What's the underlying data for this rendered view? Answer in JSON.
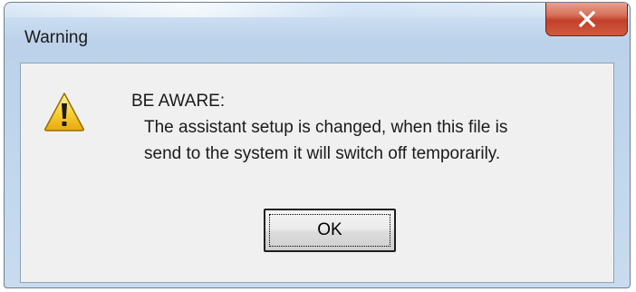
{
  "dialog": {
    "title": "Warning",
    "icon": "warning-icon",
    "message": {
      "heading": "BE AWARE:",
      "lines": [
        "The assistant setup is changed, when this file is",
        "send to the system it will switch off temporarily."
      ]
    },
    "ok_label": "OK",
    "close_icon": "close-icon"
  }
}
